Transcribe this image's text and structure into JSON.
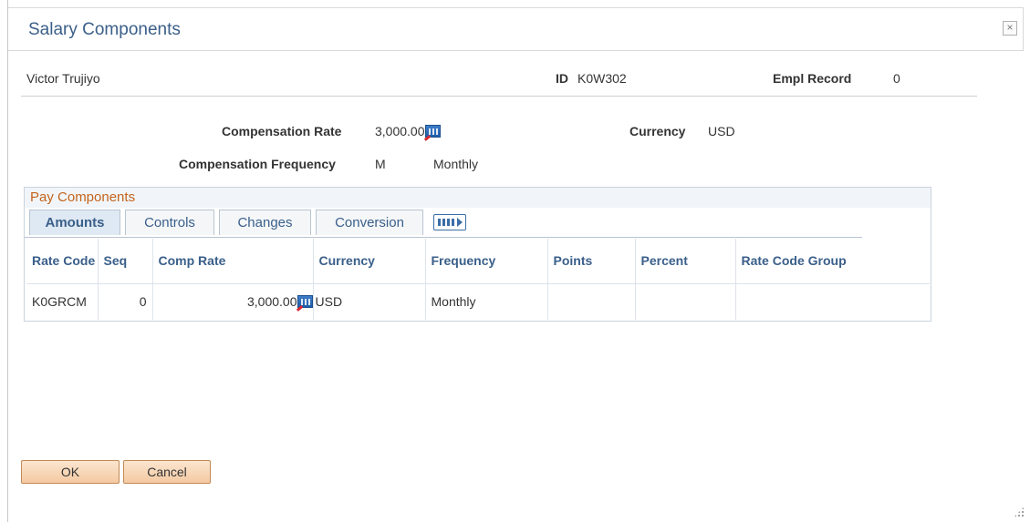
{
  "dialog": {
    "title": "Salary Components",
    "close_glyph": "×"
  },
  "header": {
    "employee_name": "Victor Trujiyo",
    "id_label": "ID",
    "id_value": "K0W302",
    "empl_record_label": "Empl Record",
    "empl_record_value": "0"
  },
  "compensation": {
    "rate_label": "Compensation Rate",
    "rate_value": "3,000.00",
    "currency_label": "Currency",
    "currency_value": "USD",
    "frequency_label": "Compensation Frequency",
    "frequency_code": "M",
    "frequency_desc": "Monthly"
  },
  "pay_components": {
    "title": "Pay Components",
    "tabs": [
      {
        "label": "Amounts",
        "active": true
      },
      {
        "label": "Controls",
        "active": false
      },
      {
        "label": "Changes",
        "active": false
      },
      {
        "label": "Conversion",
        "active": false
      }
    ],
    "columns": [
      "Rate Code",
      "Seq",
      "Comp Rate",
      "Currency",
      "Frequency",
      "Points",
      "Percent",
      "Rate Code Group"
    ],
    "rows": [
      {
        "rate_code": "K0GRCM",
        "seq": "0",
        "comp_rate": "3,000.00",
        "currency": "USD",
        "frequency": "Monthly",
        "points": "",
        "percent": "",
        "rate_code_group": ""
      }
    ]
  },
  "buttons": {
    "ok": "OK",
    "cancel": "Cancel"
  },
  "icons": {
    "calculator": "calculator-icon",
    "close": "close-icon",
    "expand_grid": "expand-grid-icon",
    "resize": "resize-grip-icon"
  },
  "colors": {
    "title": "#3a5f8a",
    "grid_title": "#c4641c",
    "button_bg": "#f4c9a1"
  }
}
